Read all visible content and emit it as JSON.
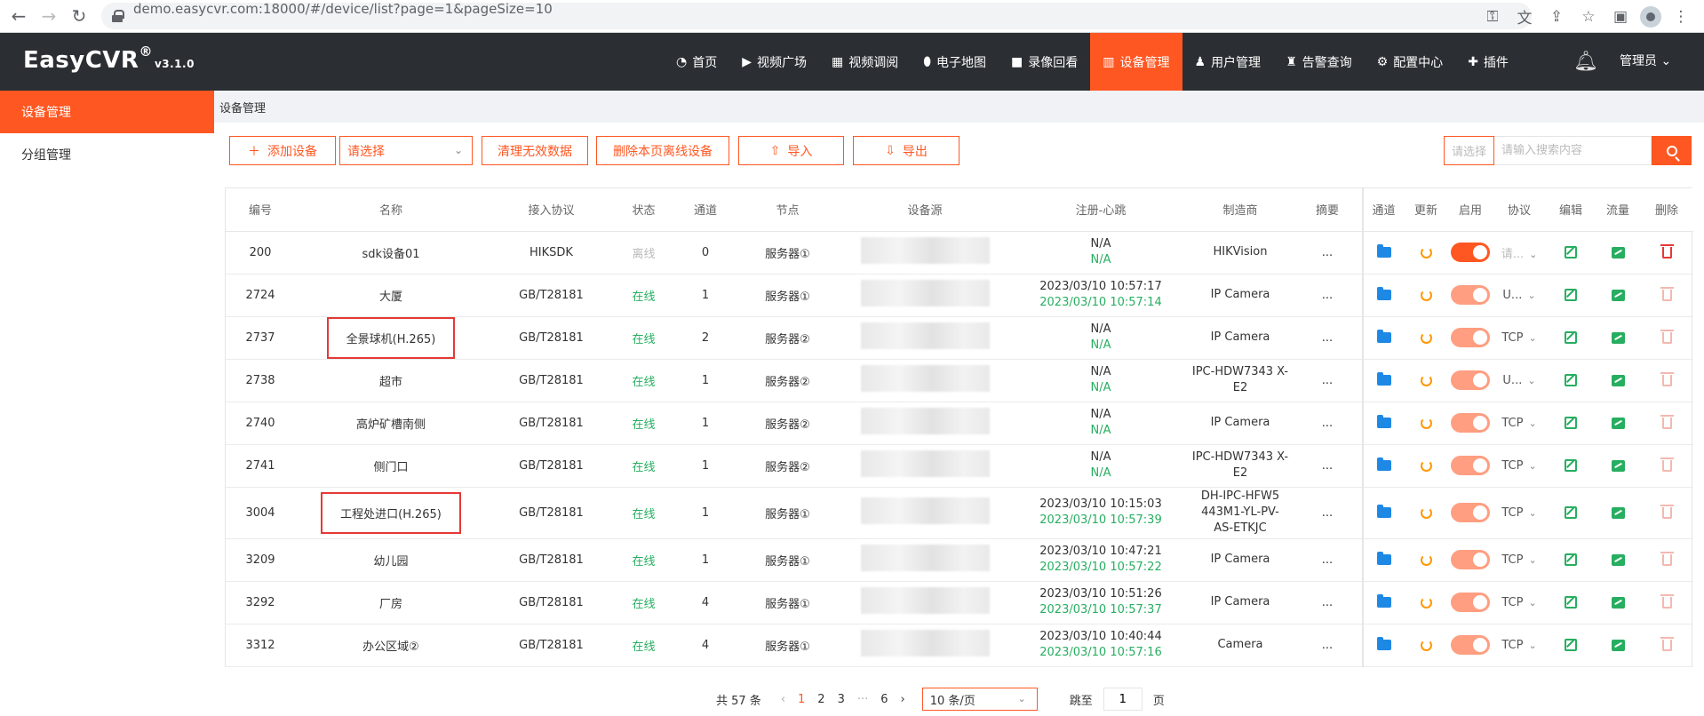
{
  "browser": {
    "url": "demo.easycvr.com:18000/#/device/list?page=1&pageSize=10"
  },
  "header": {
    "brand": "EasyCVR",
    "brand_mark": "®",
    "version": "v3.1.0",
    "nav": [
      {
        "label": "首页",
        "icon": "dashboard-icon"
      },
      {
        "label": "视频广场",
        "icon": "play-circle-icon"
      },
      {
        "label": "视频调阅",
        "icon": "grid-icon"
      },
      {
        "label": "电子地图",
        "icon": "map-pin-icon"
      },
      {
        "label": "录像回看",
        "icon": "video-camera-icon"
      },
      {
        "label": "设备管理",
        "icon": "device-list-icon",
        "active": true
      },
      {
        "label": "用户管理",
        "icon": "user-icon"
      },
      {
        "label": "告警查询",
        "icon": "alarm-icon"
      },
      {
        "label": "配置中心",
        "icon": "gear-icon"
      },
      {
        "label": "插件",
        "icon": "puzzle-icon"
      }
    ],
    "user": "管理员"
  },
  "sidebar": {
    "items": [
      {
        "label": "设备管理",
        "active": true
      },
      {
        "label": "分组管理",
        "active": false
      }
    ]
  },
  "breadcrumb": "设备管理",
  "toolbar": {
    "add_label": "添加设备",
    "select_placeholder": "请选择",
    "clean_label": "清理无效数据",
    "delete_offline_label": "删除本页离线设备",
    "import_label": "导入",
    "export_label": "导出",
    "search_select": "请选择",
    "search_placeholder": "请输入搜索内容"
  },
  "table": {
    "columns": [
      "编号",
      "名称",
      "接入协议",
      "状态",
      "通道",
      "节点",
      "设备源",
      "注册-心跳",
      "制造商",
      "摘要",
      "通道",
      "更新",
      "启用",
      "协议",
      "编辑",
      "流量",
      "删除"
    ],
    "rows": [
      {
        "id": "200",
        "name": "sdk设备01",
        "protocol": "HIKSDK",
        "status": "离线",
        "online": false,
        "channels": "0",
        "node": "服务器①",
        "reg": "N/A",
        "heartbeat": "N/A",
        "mfr": "HIKVision",
        "summary": "...",
        "enabled": true,
        "proto": "请...",
        "proto_placeholder": true,
        "deletable": true,
        "highlight": false
      },
      {
        "id": "2724",
        "name": "大厦",
        "protocol": "GB/T28181",
        "status": "在线",
        "online": true,
        "channels": "1",
        "node": "服务器①",
        "reg": "2023/03/10 10:57:17",
        "heartbeat": "2023/03/10 10:57:14",
        "mfr": "IP Camera",
        "summary": "...",
        "enabled": false,
        "proto": "U...",
        "proto_placeholder": false,
        "deletable": false,
        "highlight": false
      },
      {
        "id": "2737",
        "name": "全景球机(H.265)",
        "protocol": "GB/T28181",
        "status": "在线",
        "online": true,
        "channels": "2",
        "node": "服务器②",
        "reg": "N/A",
        "heartbeat": "N/A",
        "mfr": "IP Camera",
        "summary": "...",
        "enabled": false,
        "proto": "TCP",
        "proto_placeholder": false,
        "deletable": false,
        "highlight": true
      },
      {
        "id": "2738",
        "name": "超市",
        "protocol": "GB/T28181",
        "status": "在线",
        "online": true,
        "channels": "1",
        "node": "服务器②",
        "reg": "N/A",
        "heartbeat": "N/A",
        "mfr": "IPC-HDW7343 X-E2",
        "summary": "...",
        "enabled": false,
        "proto": "U...",
        "proto_placeholder": false,
        "deletable": false,
        "highlight": false
      },
      {
        "id": "2740",
        "name": "高炉矿槽南侧",
        "protocol": "GB/T28181",
        "status": "在线",
        "online": true,
        "channels": "1",
        "node": "服务器②",
        "reg": "N/A",
        "heartbeat": "N/A",
        "mfr": "IP Camera",
        "summary": "...",
        "enabled": false,
        "proto": "TCP",
        "proto_placeholder": false,
        "deletable": false,
        "highlight": false
      },
      {
        "id": "2741",
        "name": "侧门口",
        "protocol": "GB/T28181",
        "status": "在线",
        "online": true,
        "channels": "1",
        "node": "服务器②",
        "reg": "N/A",
        "heartbeat": "N/A",
        "mfr": "IPC-HDW7343 X-E2",
        "summary": "...",
        "enabled": false,
        "proto": "TCP",
        "proto_placeholder": false,
        "deletable": false,
        "highlight": false
      },
      {
        "id": "3004",
        "name": "工程处进口(H.265)",
        "protocol": "GB/T28181",
        "status": "在线",
        "online": true,
        "channels": "1",
        "node": "服务器①",
        "reg": "2023/03/10 10:15:03",
        "heartbeat": "2023/03/10 10:57:39",
        "mfr": "DH-IPC-HFW5 443M1-YL-PV- AS-ETKJC",
        "summary": "...",
        "enabled": false,
        "proto": "TCP",
        "proto_placeholder": false,
        "deletable": false,
        "highlight": true,
        "tall": true
      },
      {
        "id": "3209",
        "name": "幼儿园",
        "protocol": "GB/T28181",
        "status": "在线",
        "online": true,
        "channels": "1",
        "node": "服务器①",
        "reg": "2023/03/10 10:47:21",
        "heartbeat": "2023/03/10 10:57:22",
        "mfr": "IP Camera",
        "summary": "...",
        "enabled": false,
        "proto": "TCP",
        "proto_placeholder": false,
        "deletable": false,
        "highlight": false
      },
      {
        "id": "3292",
        "name": "厂房",
        "protocol": "GB/T28181",
        "status": "在线",
        "online": true,
        "channels": "4",
        "node": "服务器①",
        "reg": "2023/03/10 10:51:26",
        "heartbeat": "2023/03/10 10:57:37",
        "mfr": "IP Camera",
        "summary": "...",
        "enabled": false,
        "proto": "TCP",
        "proto_placeholder": false,
        "deletable": false,
        "highlight": false
      },
      {
        "id": "3312",
        "name": "办公区域②",
        "protocol": "GB/T28181",
        "status": "在线",
        "online": true,
        "channels": "4",
        "node": "服务器①",
        "reg": "2023/03/10 10:40:44",
        "heartbeat": "2023/03/10 10:57:16",
        "mfr": "Camera",
        "summary": "...",
        "enabled": false,
        "proto": "TCP",
        "proto_placeholder": false,
        "deletable": false,
        "highlight": false
      }
    ]
  },
  "pagination": {
    "total": "共 57 条",
    "prev": "‹",
    "pages": [
      "1",
      "2",
      "3",
      "···",
      "6"
    ],
    "current": "1",
    "next": "›",
    "page_size": "10 条/页",
    "jump_prefix": "跳至",
    "jump_value": "1",
    "jump_suffix": "页"
  },
  "colors": {
    "accent": "#ff5722",
    "header_bg": "#2b2f33",
    "online": "#27ae60",
    "highlight_box": "#e53935"
  }
}
